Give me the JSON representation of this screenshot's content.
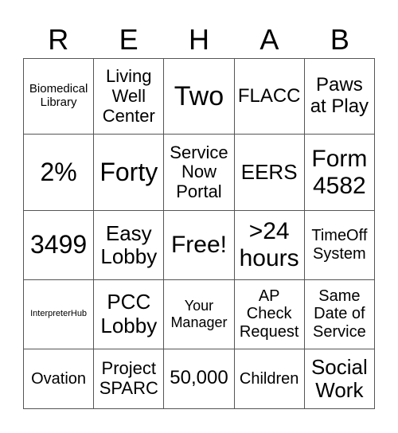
{
  "title_letters": [
    "R",
    "E",
    "H",
    "A",
    "B"
  ],
  "rows": [
    [
      "Biomedical\nLibrary",
      "Living\nWell\nCenter",
      "Two",
      "FLACC",
      "Paws\nat Play"
    ],
    [
      "2%",
      "Forty",
      "Service\nNow\nPortal",
      "EERS",
      "Form\n4582"
    ],
    [
      "3499",
      "Easy\nLobby",
      "Free!",
      ">24\nhours",
      "TimeOff\nSystem"
    ],
    [
      "InterpreterHub",
      "PCC\nLobby",
      "Your\nManager",
      "AP\nCheck\nRequest",
      "Same\nDate of\nService"
    ],
    [
      "Ovation",
      "Project\nSPARC",
      "50,000",
      "Children",
      "Social\nWork"
    ]
  ]
}
